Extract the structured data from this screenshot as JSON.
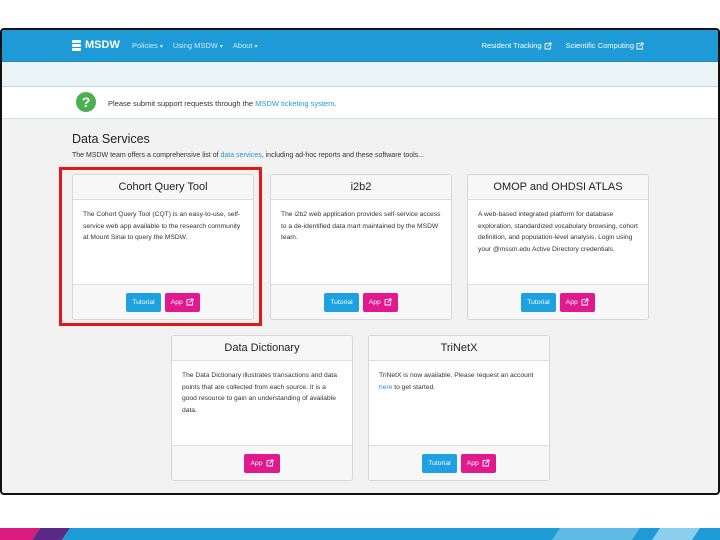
{
  "navbar": {
    "brand": "MSDW",
    "menu": [
      {
        "label": "Policies"
      },
      {
        "label": "Using MSDW"
      },
      {
        "label": "About"
      }
    ],
    "right_links": [
      {
        "label": "Resident Tracking"
      },
      {
        "label": "Scientific Computing"
      }
    ]
  },
  "alert": {
    "text_before": "Please submit support requests through the ",
    "link": "MSDW ticketing system",
    "text_after": "."
  },
  "section": {
    "title": "Data Services",
    "desc_before": "The MSDW team offers a comprehensive list of ",
    "desc_link": "data services",
    "desc_after": ", including ad-hoc reports and these software tools..."
  },
  "cards": {
    "cqt": {
      "title": "Cohort Query Tool",
      "body": "The Cohort Query Tool (CQT) is an easy-to-use, self-service web app available to the research community at Mount Sinai to query the MSDW.",
      "tutorial": "Tutorial",
      "app": "App"
    },
    "i2b2": {
      "title": "i2b2",
      "body": "The i2b2 web application provides self-service access to a de-identified data mart maintained by the MSDW team.",
      "tutorial": "Tutorial",
      "app": "App"
    },
    "omop": {
      "title": "OMOP and OHDSI ATLAS",
      "body": "A web-based integrated platform for database exploration, standardized vocabulary browsing, cohort definition, and population-level analysis. Login using your @mssm.edu Active Directory credentials.",
      "tutorial": "Tutorial",
      "app": "App"
    },
    "dictionary": {
      "title": "Data Dictionary",
      "body": "The Data Dictionary illustrates transactions and data points that are collected from each source. It is a good resource to gain an understanding of available data.",
      "app": "App"
    },
    "trinetx": {
      "title": "TriNetX",
      "body_before": "TriNetX is now available. Please request an account ",
      "body_link": "here",
      "body_after": " to get started.",
      "tutorial": "Tutorial",
      "app": "App"
    }
  },
  "colors": {
    "navbar": "#1e9ad6",
    "tutorial_button": "#1ea1e0",
    "app_button": "#e0198f",
    "highlight": "#e51818",
    "alert_icon": "#4caf50"
  }
}
